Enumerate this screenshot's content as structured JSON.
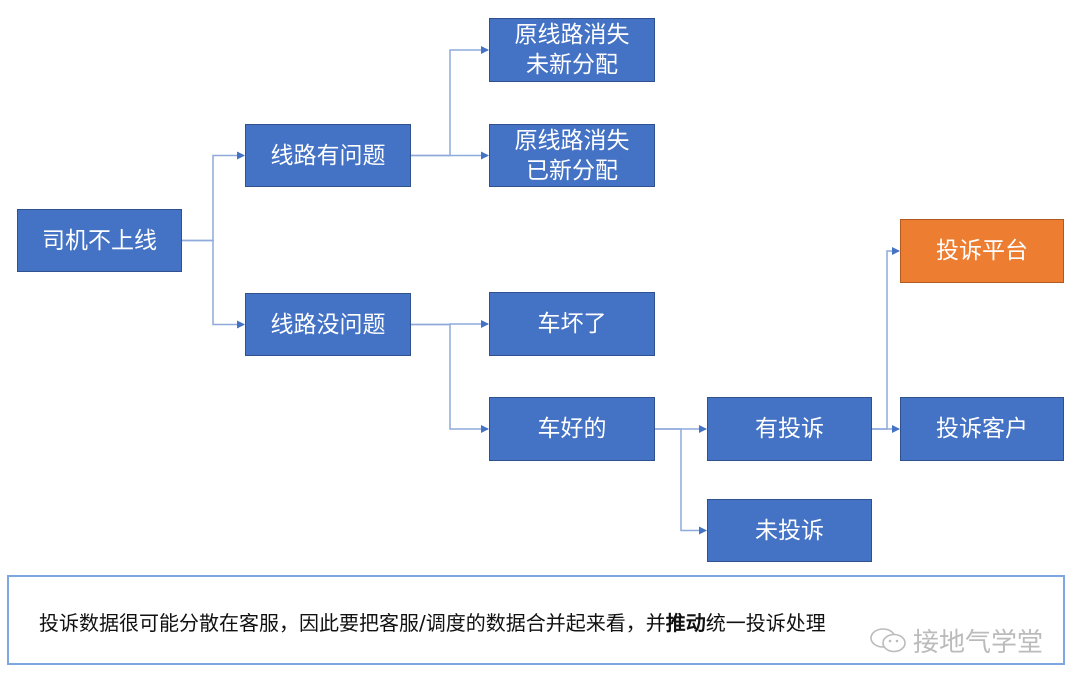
{
  "nodes": [
    {
      "id": "root",
      "label_lines": [
        "司机不上线"
      ],
      "color": "#4472c4"
    },
    {
      "id": "route-problem",
      "label_lines": [
        "线路有问题"
      ],
      "color": "#4472c4"
    },
    {
      "id": "route-ok",
      "label_lines": [
        "线路没问题"
      ],
      "color": "#4472c4"
    },
    {
      "id": "route-gone-unassigned",
      "label_lines": [
        "原线路消失",
        "未新分配"
      ],
      "color": "#4472c4"
    },
    {
      "id": "route-gone-assigned",
      "label_lines": [
        "原线路消失",
        "已新分配"
      ],
      "color": "#4472c4"
    },
    {
      "id": "car-broken",
      "label_lines": [
        "车坏了"
      ],
      "color": "#4472c4"
    },
    {
      "id": "car-ok",
      "label_lines": [
        "车好的"
      ],
      "color": "#4472c4"
    },
    {
      "id": "has-complaint",
      "label_lines": [
        "有投诉"
      ],
      "color": "#4472c4"
    },
    {
      "id": "no-complaint",
      "label_lines": [
        "未投诉"
      ],
      "color": "#4472c4"
    },
    {
      "id": "complaint-platform",
      "label_lines": [
        "投诉平台"
      ],
      "color": "#ed7d31"
    },
    {
      "id": "complaint-customer",
      "label_lines": [
        "投诉客户"
      ],
      "color": "#4472c4"
    }
  ],
  "edges": [
    {
      "from": "root",
      "to": "route-problem"
    },
    {
      "from": "root",
      "to": "route-ok"
    },
    {
      "from": "route-problem",
      "to": "route-gone-unassigned"
    },
    {
      "from": "route-problem",
      "to": "route-gone-assigned"
    },
    {
      "from": "route-ok",
      "to": "car-broken"
    },
    {
      "from": "route-ok",
      "to": "car-ok"
    },
    {
      "from": "car-ok",
      "to": "has-complaint"
    },
    {
      "from": "car-ok",
      "to": "no-complaint"
    },
    {
      "from": "has-complaint",
      "to": "complaint-platform"
    },
    {
      "from": "has-complaint",
      "to": "complaint-customer"
    }
  ],
  "colors": {
    "node_blue": "#4472c4",
    "node_orange": "#ed7d31",
    "connector": "#8eaadb",
    "arrow": "#4472c4",
    "note_border": "#7ea6e0"
  },
  "note": {
    "text_before": "投诉数据很可能分散在客服，因此要把客服/调度的数据合并起来看，并",
    "text_bold": "推动",
    "text_after": "统一投诉处理"
  },
  "watermark": {
    "icon": "wechat-icon",
    "text": "接地气学堂"
  }
}
